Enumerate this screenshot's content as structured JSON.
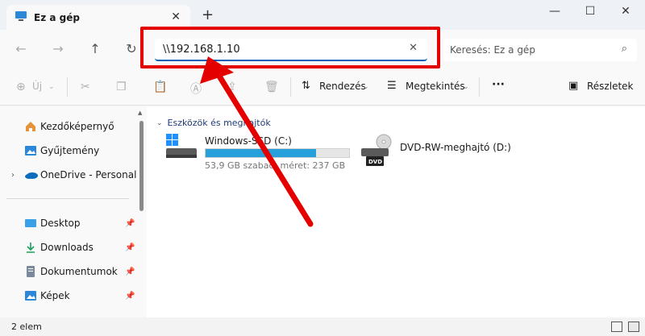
{
  "window": {
    "tab_title": "Ez a gép",
    "close_tab": "✕",
    "new_tab": "+",
    "minimize": "—",
    "maximize": "☐",
    "close": "✕"
  },
  "address": {
    "path": "\\\\192.168.1.10",
    "clear": "✕"
  },
  "search": {
    "placeholder": "Keresés: Ez a gép"
  },
  "toolbar": {
    "new_label": "Új",
    "sort_label": "Rendezés",
    "view_label": "Megtekintés",
    "more_label": "···",
    "details_label": "Részletek"
  },
  "sidebar": {
    "items": [
      {
        "label": "Kezdőképernyő"
      },
      {
        "label": "Gyűjtemény"
      },
      {
        "label": "OneDrive - Personal"
      },
      {
        "label": "Desktop"
      },
      {
        "label": "Downloads"
      },
      {
        "label": "Dokumentumok"
      },
      {
        "label": "Képek"
      }
    ]
  },
  "main": {
    "group_header": "Eszközök és meghajtók",
    "drives": [
      {
        "name": "Windows-SSD (C:)",
        "free_text": "53,9 GB szabad, méret: 237 GB",
        "used_fraction": 0.77
      },
      {
        "name": "DVD-RW-meghajtó (D:)",
        "badge": "DVD"
      }
    ]
  },
  "status": {
    "count": "2 elem"
  },
  "colors": {
    "accent": "#005fb8",
    "highlight": "#e50000",
    "bar_fill": "#26a0da"
  }
}
